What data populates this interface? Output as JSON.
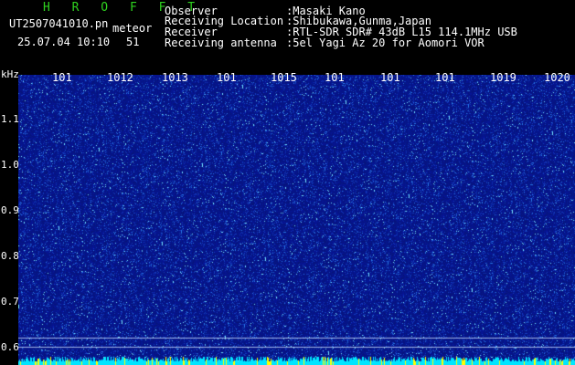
{
  "header": {
    "brand": "H R O F F T",
    "filename": "UT2507041010.pn",
    "tag": "meteor",
    "date": "25.07.04 10:10",
    "count": "51",
    "fields": [
      {
        "label": "Observer",
        "value": ":Masaki Kano"
      },
      {
        "label": "Receiving Location",
        "value": ":Shibukawa,Gunma,Japan"
      },
      {
        "label": "Receiver",
        "value": ":RTL-SDR SDR# 43dB L15 114.1MHz USB"
      },
      {
        "label": "Receiving antenna",
        "value": ":5el Yagi Az 20 for Aomori VOR"
      }
    ]
  },
  "axis": {
    "y_unit": "kHz",
    "y_ticks": [
      "1.1",
      "1.0",
      "0.9",
      "0.8",
      "0.7",
      "0.6"
    ],
    "x_ticks": [
      "101",
      "1012",
      "1013",
      "101",
      "1015",
      "101",
      "101",
      "101",
      "1019",
      "1020"
    ]
  },
  "colors": {
    "background": "#000000",
    "noise_base": "#0a1e8c",
    "trace": "#00e5ff",
    "burst": "#ffff00",
    "brand": "#2fd21f"
  }
}
